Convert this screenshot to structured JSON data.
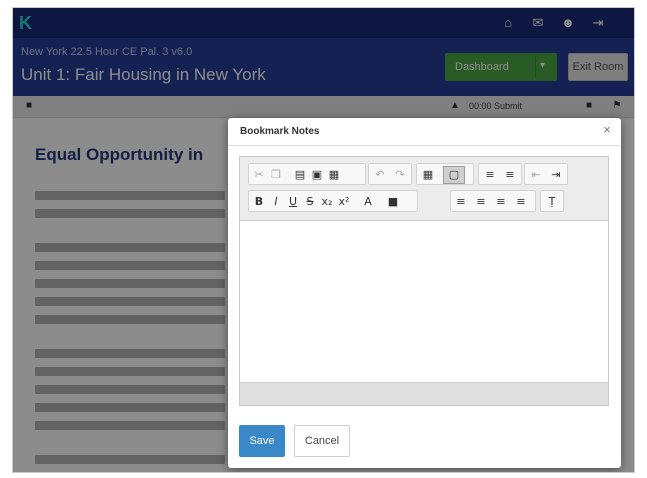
{
  "topnav": {
    "logo": "K",
    "icons": [
      "home-icon",
      "mail-icon",
      "user-icon",
      "exit-icon"
    ]
  },
  "course": {
    "subtitle": "New York 22.5 Hour CE Pal. 3 v6.0",
    "title": "Unit 1: Fair Housing in New York",
    "dashboard_label": "Dashboard",
    "exit_label": "Exit Room"
  },
  "content_toolbar": {
    "timer": "00:00 Submit"
  },
  "lesson": {
    "title": "Equal Opportunity in"
  },
  "modal": {
    "title": "Bookmark Notes",
    "save_label": "Save",
    "cancel_label": "Cancel"
  },
  "editor": {
    "toolbar_row1": [
      "cut-icon",
      "copy-icon",
      "paste-icon",
      "paste-text-icon",
      "paste-word-icon",
      "undo-icon",
      "redo-icon",
      "table-icon",
      "comment-icon",
      "numbered-list-icon",
      "bulleted-list-icon",
      "outdent-icon",
      "indent-icon"
    ],
    "toolbar_row2": [
      "bold-icon",
      "italic-icon",
      "underline-icon",
      "strikethrough-icon",
      "subscript-icon",
      "superscript-icon",
      "text-color-icon",
      "background-color-icon",
      "align-left-icon",
      "align-center-icon",
      "align-right-icon",
      "justify-icon",
      "remove-format-icon"
    ]
  }
}
